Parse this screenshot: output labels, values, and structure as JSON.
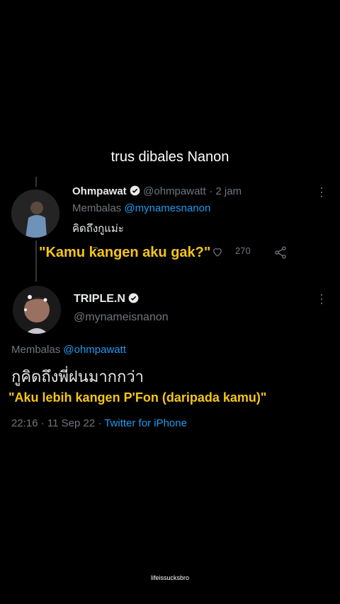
{
  "caption_top": "trus dibales Nanon",
  "reply_tweet": {
    "display_name": "Ohmpawat",
    "handle": "@ohmpawatt",
    "time": "· 2 jam",
    "replying_label": "Membalas",
    "replying_to": "@mynamesnanon",
    "text": "คิดถึงกูแม่ะ",
    "subtitle": "\"Kamu kangen aku gak?\"",
    "like_count": "270"
  },
  "main_tweet": {
    "display_name": "TRIPLE.N",
    "handle": "@mynameisnanon",
    "replying_label": "Membalas",
    "replying_to": "@ohmpawatt",
    "text": "กูคิดถึงพี่ฝนมากกว่า",
    "subtitle": "\"Aku lebih kangen P'Fon (daripada kamu)\"",
    "timestamp": "22:16 · 11 Sep 22 ·",
    "client": "Twitter for iPhone"
  },
  "footer_tag": "lifeissucksbro",
  "colors": {
    "background": "#000000",
    "link": "#1d9bf0",
    "verified": "#e7e9ea",
    "subtitle": "#f5c518"
  },
  "icons": [
    "verified-icon",
    "more-icon",
    "reply-icon",
    "retweet-icon",
    "like-icon",
    "share-icon"
  ]
}
